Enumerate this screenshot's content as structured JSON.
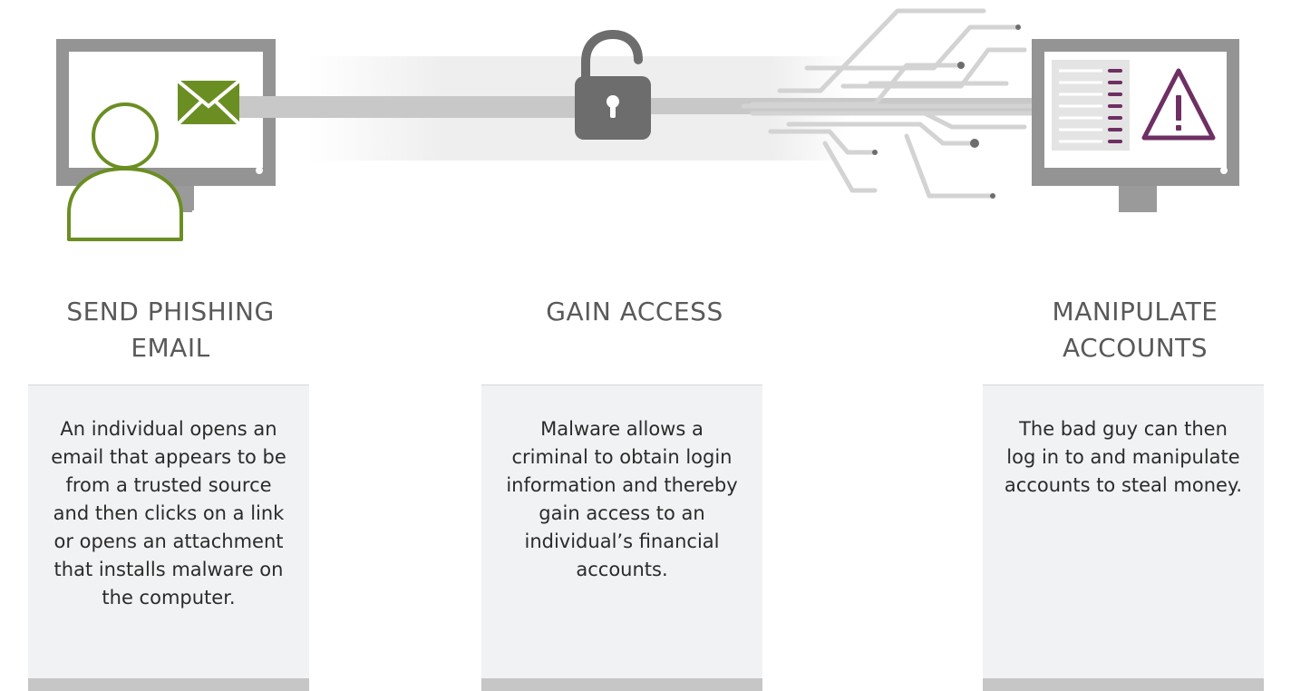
{
  "steps": [
    {
      "title_line1": "SEND PHISHING",
      "title_line2": "EMAIL",
      "description": "An individual opens an email that appears to be from a trusted source and then clicks on a link or opens an attachment that installs malware on the computer."
    },
    {
      "title_line1": "GAIN ACCESS",
      "title_line2": "",
      "description": "Malware allows a criminal to obtain login information and thereby gain access to an individual’s financial accounts."
    },
    {
      "title_line1": "MANIPULATE",
      "title_line2": "ACCOUNTS",
      "description": "The bad guy can then log in to and manipulate accounts to steal money."
    }
  ],
  "icons": {
    "left_monitor": "monitor-icon",
    "user": "user-icon",
    "email": "envelope-icon",
    "lock": "padlock-open-icon",
    "circuit": "circuit-lines-icon",
    "right_monitor": "monitor-icon",
    "document": "document-list-icon",
    "warning": "warning-triangle-icon"
  },
  "colors": {
    "monitor_gray": "#949494",
    "accent_green": "#6b8e23",
    "accent_purple": "#6e2f63",
    "lock_gray": "#6d6d6d",
    "card_bg": "#f1f2f3",
    "card_bar": "#c6c6c6"
  }
}
